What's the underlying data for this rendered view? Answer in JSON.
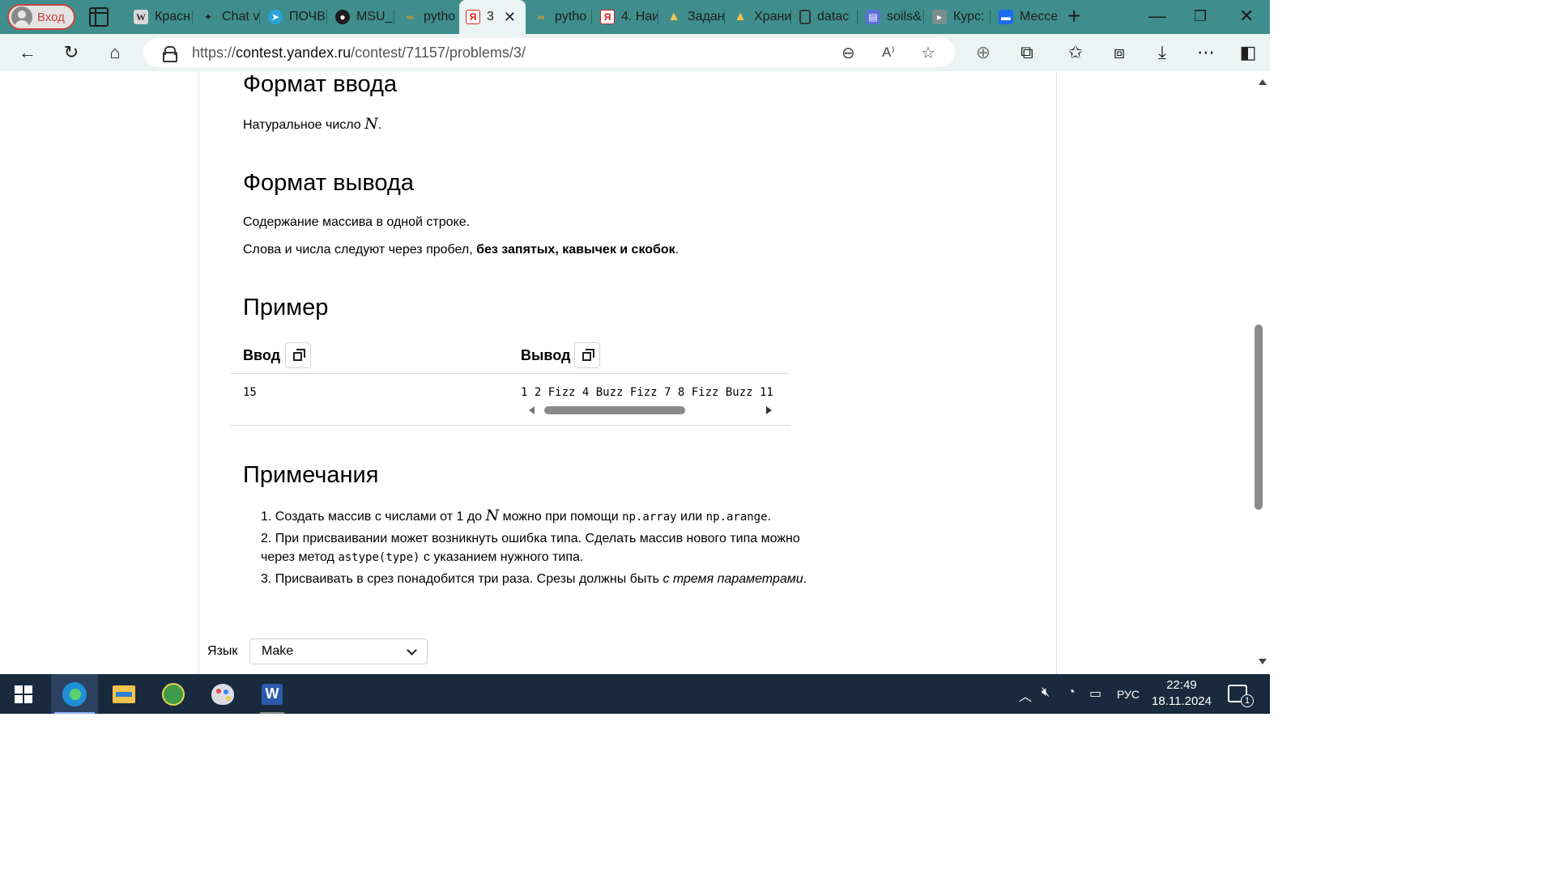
{
  "browser": {
    "profile_label": "Вход",
    "tabs": [
      {
        "title": "Красн",
        "icon": "wikipedia-icon"
      },
      {
        "title": "Chat v",
        "icon": "chat-icon"
      },
      {
        "title": "ПОЧВ",
        "icon": "telegram-icon"
      },
      {
        "title": "MSU_I",
        "icon": "github-icon"
      },
      {
        "title": "pytho",
        "icon": "link-icon"
      },
      {
        "title": "3",
        "icon": "yandex-icon",
        "active": true
      },
      {
        "title": "pytho",
        "icon": "link-icon"
      },
      {
        "title": "4. Наи",
        "icon": "yandex-icon"
      },
      {
        "title": "Задан",
        "icon": "google-drive-icon"
      },
      {
        "title": "Храни",
        "icon": "google-drive-icon"
      },
      {
        "title": "datac",
        "icon": "document-icon"
      },
      {
        "title": "soils&",
        "icon": "forms-icon"
      },
      {
        "title": "Курс:",
        "icon": "course-icon"
      },
      {
        "title": "Мессе",
        "icon": "messenger-icon"
      }
    ],
    "url_prefix": "https://",
    "url_host": "contest.yandex.ru",
    "url_path": "/contest/71157/problems/3/"
  },
  "problem": {
    "input_heading": "Формат ввода",
    "input_text_before": "Натуральное число ",
    "input_var": "N",
    "input_text_after": ".",
    "output_heading": "Формат вывода",
    "output_line1": "Содержание массива в одной строке.",
    "output_line2_before": "Слова и числа следуют через пробел, ",
    "output_line2_bold": "без запятых, кавычек и скобок",
    "output_line2_after": ".",
    "example_heading": "Пример",
    "example": {
      "input_label": "Ввод",
      "output_label": "Вывод",
      "input_value": "15",
      "output_value": "1 2 Fizz 4 Buzz Fizz 7 8 Fizz Buzz 11"
    },
    "notes_heading": "Примечания",
    "notes": {
      "n1_a": "1. Создать массив с числами от 1 до ",
      "n1_var": "N",
      "n1_b": " можно при помощи ",
      "n1_code1": "np.array",
      "n1_c": " или ",
      "n1_code2": "np.arange",
      "n1_d": ".",
      "n2_line1": "2. При присваивании может возникнуть ошибка типа. Сделать массив нового типа можно",
      "n2_a": "через метод ",
      "n2_code": "astype(type)",
      "n2_b": " с указанием нужного типа.",
      "n3_a": "3. Присваивать в срез понадобится три раза. Срезы должны быть ",
      "n3_em": "с тремя параметрами",
      "n3_b": "."
    },
    "language_label": "Язык",
    "language_value": "Make"
  },
  "taskbar": {
    "lang": "РУС",
    "time": "22:49",
    "date": "18.11.2024",
    "notifications": "1"
  },
  "colors": {
    "tabstrip": "#3f8d8d",
    "toolbar": "#ebf3f3",
    "taskbar": "#1a2a3e"
  }
}
